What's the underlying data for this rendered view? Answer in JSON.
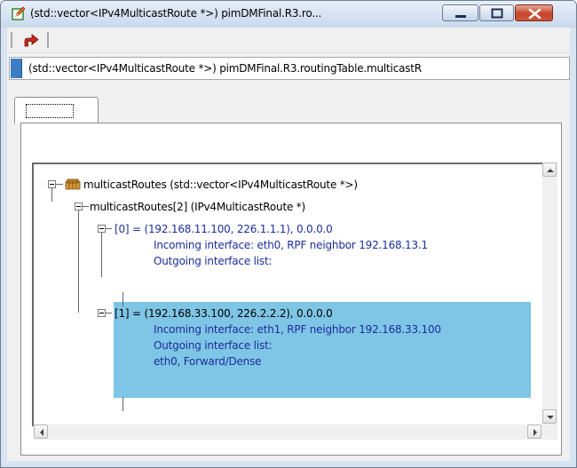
{
  "window": {
    "title": "(std::vector<IPv4MulticastRoute *>) pimDMFinal.R3.ro...",
    "icon": "inspector-edit-icon",
    "controls": [
      "minimize-icon",
      "maximize-icon",
      "close-icon"
    ]
  },
  "toolbar": {
    "buttons": [
      {
        "icon": "go-to-parent-arrow-icon"
      }
    ]
  },
  "pathbar": {
    "text": "(std::vector<IPv4MulticastRoute *>) pimDMFinal.R3.routingTable.multicastR"
  },
  "tabs": [
    {
      "label": ""
    }
  ],
  "tree": {
    "root": {
      "label": "multicastRoutes (std::vector<IPv4MulticastRoute *>)",
      "icon": "object-container-icon"
    },
    "vector": {
      "label": "multicastRoutes[2] (IPv4MulticastRoute *)"
    },
    "items": [
      {
        "lines": [
          "[0] = (192.168.11.100,  226.1.1.1),  0.0.0.0",
          "Incoming interface: eth0, RPF neighbor 192.168.13.1",
          "Outgoing interface list:"
        ],
        "selected": false
      },
      {
        "lines": [
          "[1] = (192.168.33.100,  226.2.2.2),  0.0.0.0",
          "Incoming interface: eth1, RPF neighbor 192.168.33.100",
          "Outgoing interface list:",
          "eth0, Forward/Dense"
        ],
        "selected": true
      }
    ]
  },
  "colors": {
    "selection": "#7ec5e6",
    "item_text": "#1c2d9c"
  }
}
